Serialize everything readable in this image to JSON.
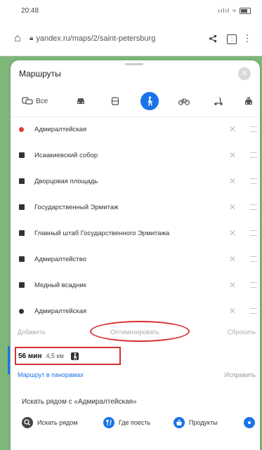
{
  "status_bar": {
    "time": "20:48",
    "signal": "ıılıl",
    "wifi": "≈"
  },
  "browser": {
    "url": "yandex.ru/maps/2/saint-petersburg"
  },
  "panel": {
    "title": "Маршруты",
    "modes": [
      {
        "icon": "all-modes-icon",
        "label": "Все"
      },
      {
        "icon": "car-icon",
        "label": ""
      },
      {
        "icon": "bus-icon",
        "label": ""
      },
      {
        "icon": "pedestrian-icon",
        "label": "",
        "active": true
      },
      {
        "icon": "bicycle-icon",
        "label": ""
      },
      {
        "icon": "scooter-icon",
        "label": ""
      },
      {
        "icon": "taxi-icon",
        "label": ""
      }
    ],
    "stops": [
      {
        "name": "Адмиралтейская",
        "marker": "start"
      },
      {
        "name": "Исаакиевский собор",
        "marker": "waypoint"
      },
      {
        "name": "Дворцовая площадь",
        "marker": "waypoint"
      },
      {
        "name": "Государственный Эрмитаж",
        "marker": "waypoint"
      },
      {
        "name": "Главный штаб Государственного Эрмитажа",
        "marker": "waypoint"
      },
      {
        "name": "Адмиралтейство",
        "marker": "waypoint"
      },
      {
        "name": "Медный всадник",
        "marker": "waypoint"
      },
      {
        "name": "Адмиралтейская",
        "marker": "end"
      }
    ],
    "actions": {
      "add": "Добавить",
      "optimize": "Оптимизировать",
      "reset": "Сбросить"
    },
    "summary": {
      "duration": "56 мин",
      "distance": "4,5 км"
    },
    "panorama_link": "Маршрут в панорамах",
    "fix_link": "Исправить",
    "nearby_title": "Искать рядом с «Адмиралтейская»",
    "chips": [
      {
        "label": "Искать рядом",
        "icon": "search-icon",
        "color": "#444444"
      },
      {
        "label": "Где поесть",
        "icon": "fork-knife-icon",
        "color": "#1a73e8"
      },
      {
        "label": "Продукты",
        "icon": "basket-icon",
        "color": "#1a73e8"
      }
    ]
  },
  "colors": {
    "accent": "#1a73e8",
    "annotation": "#d83030",
    "start_marker": "#e53935"
  }
}
